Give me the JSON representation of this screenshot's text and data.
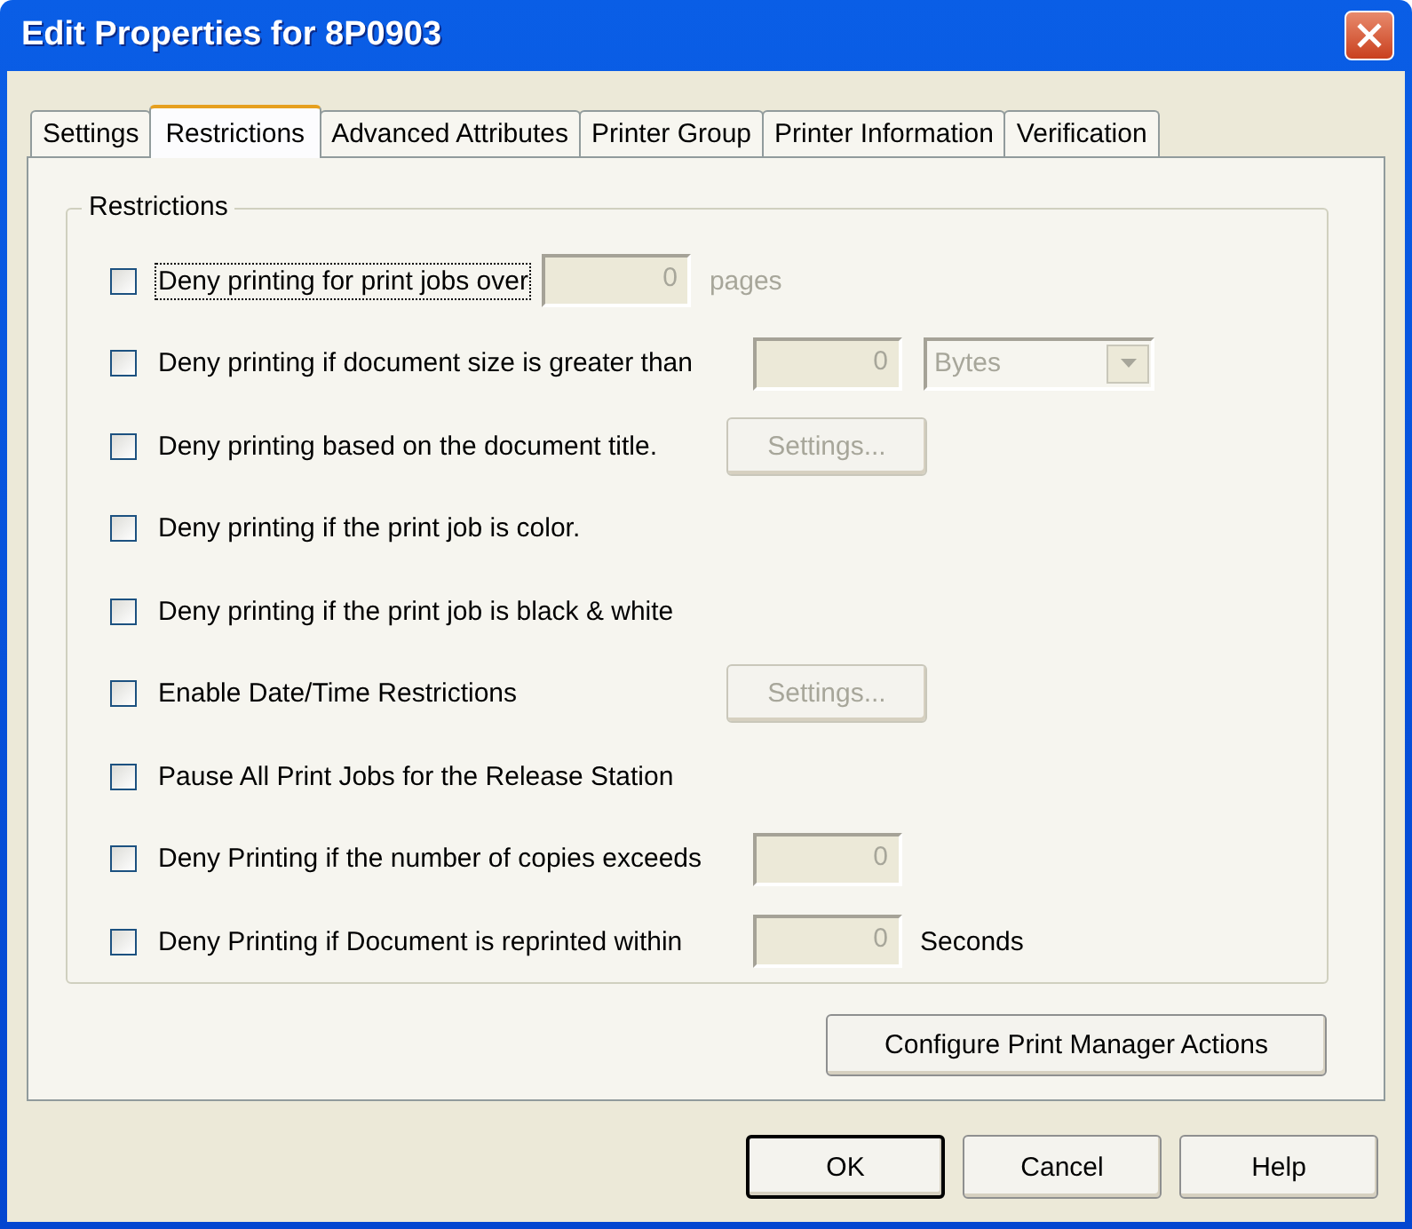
{
  "window": {
    "title": "Edit Properties for 8P0903"
  },
  "tabs": [
    {
      "label": "Settings",
      "selected": false
    },
    {
      "label": "Restrictions",
      "selected": true
    },
    {
      "label": "Advanced Attributes",
      "selected": false
    },
    {
      "label": "Printer Group",
      "selected": false
    },
    {
      "label": "Printer Information",
      "selected": false
    },
    {
      "label": "Verification",
      "selected": false
    }
  ],
  "group": {
    "title": "Restrictions"
  },
  "rows": [
    {
      "kind": "inline",
      "label": "Deny printing for print jobs over",
      "checked": false,
      "focused": true,
      "controls": [
        {
          "kind": "field",
          "value": "0",
          "disabled": true
        },
        {
          "kind": "unit",
          "text": "pages",
          "disabled": true
        }
      ]
    },
    {
      "kind": "aligned",
      "label": "Deny printing if document size is greater than",
      "checked": false,
      "focused": false,
      "controls": [
        {
          "kind": "field",
          "value": "0",
          "disabled": true
        },
        {
          "kind": "dropdown",
          "value": "Bytes",
          "disabled": true
        }
      ]
    },
    {
      "kind": "aligned",
      "label": "Deny printing based on the document title.",
      "checked": false,
      "focused": false,
      "controls": [
        {
          "kind": "button",
          "text": "Settings...",
          "disabled": true
        }
      ]
    },
    {
      "kind": "aligned",
      "label": "Deny printing if the print job is color.",
      "checked": false,
      "focused": false,
      "controls": []
    },
    {
      "kind": "aligned",
      "label": "Deny printing if the print job is black & white",
      "checked": false,
      "focused": false,
      "controls": []
    },
    {
      "kind": "aligned",
      "label": "Enable Date/Time Restrictions",
      "checked": false,
      "focused": false,
      "controls": [
        {
          "kind": "button",
          "text": "Settings...",
          "disabled": true
        }
      ]
    },
    {
      "kind": "aligned",
      "label": "Pause All Print Jobs for the Release Station",
      "checked": false,
      "focused": false,
      "controls": []
    },
    {
      "kind": "aligned",
      "label": "Deny Printing if the number of copies exceeds",
      "checked": false,
      "focused": false,
      "controls": [
        {
          "kind": "field",
          "value": "0",
          "disabled": true
        }
      ]
    },
    {
      "kind": "aligned",
      "label": "Deny Printing if Document is reprinted within",
      "checked": false,
      "focused": false,
      "controls": [
        {
          "kind": "field",
          "value": "0",
          "disabled": true
        },
        {
          "kind": "unit",
          "text": "Seconds",
          "disabled": false
        }
      ]
    }
  ],
  "action_button": "Configure Print Manager Actions",
  "buttons": [
    {
      "label": "OK",
      "default": true
    },
    {
      "label": "Cancel",
      "default": false
    },
    {
      "label": "Help",
      "default": false
    }
  ]
}
